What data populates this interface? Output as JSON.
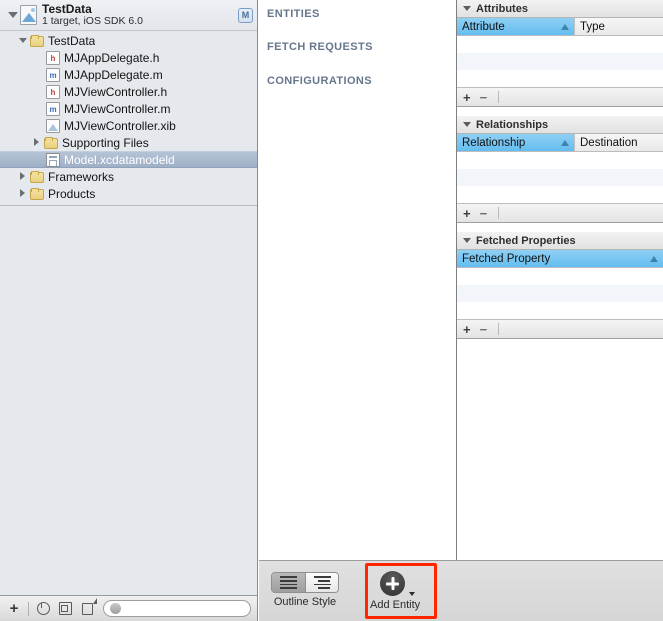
{
  "navigator": {
    "project": {
      "name": "TestData",
      "subtitle": "1 target, iOS SDK 6.0",
      "badge": "M"
    },
    "rows": [
      {
        "label": "TestData",
        "icon": "folder-icon",
        "twist": "open",
        "indent": 17,
        "selected": false
      },
      {
        "label": "MJAppDelegate.h",
        "icon": "header-file-icon",
        "twist": "none",
        "indent": 45,
        "selected": false
      },
      {
        "label": "MJAppDelegate.m",
        "icon": "implementation-file-icon",
        "twist": "none",
        "indent": 45,
        "selected": false
      },
      {
        "label": "MJViewController.h",
        "icon": "header-file-icon",
        "twist": "none",
        "indent": 45,
        "selected": false
      },
      {
        "label": "MJViewController.m",
        "icon": "implementation-file-icon",
        "twist": "none",
        "indent": 45,
        "selected": false
      },
      {
        "label": "MJViewController.xib",
        "icon": "xib-file-icon",
        "twist": "none",
        "indent": 45,
        "selected": false
      },
      {
        "label": "Supporting Files",
        "icon": "folder-icon",
        "twist": "closed",
        "indent": 31,
        "selected": false
      },
      {
        "label": "Model.xcdatamodeld",
        "icon": "datamodel-file-icon",
        "twist": "none",
        "indent": 45,
        "selected": true
      },
      {
        "label": "Frameworks",
        "icon": "folder-icon",
        "twist": "closed",
        "indent": 17,
        "selected": false
      },
      {
        "label": "Products",
        "icon": "folder-icon",
        "twist": "closed",
        "indent": 17,
        "selected": false
      }
    ],
    "bottom_bar": {
      "add_icon": "add-icon",
      "recent_icon": "clock-icon",
      "source_control_icon": "source-control-icon",
      "edit_icon": "edit-filter-icon",
      "search_placeholder": ""
    }
  },
  "editor": {
    "sections": [
      {
        "label": "ENTITIES"
      },
      {
        "label": "FETCH REQUESTS"
      },
      {
        "label": "CONFIGURATIONS"
      }
    ],
    "bottom_bar": {
      "outline_style_label": "Outline Style",
      "add_entity_label": "Add Entity",
      "outline_style_selected_index": 0,
      "highlight_color": "#ff2600"
    }
  },
  "inspector": {
    "panels": [
      {
        "title": "Attributes",
        "columns": [
          {
            "label": "Attribute",
            "sorted": true,
            "sort_direction": "ascending"
          },
          {
            "label": "Type",
            "sorted": false
          }
        ],
        "rows": [],
        "footer": {
          "add": "+",
          "remove": "−"
        }
      },
      {
        "title": "Relationships",
        "columns": [
          {
            "label": "Relationship",
            "sorted": true,
            "sort_direction": "ascending"
          },
          {
            "label": "Destination",
            "sorted": false
          }
        ],
        "rows": [],
        "footer": {
          "add": "+",
          "remove": "−"
        }
      },
      {
        "title": "Fetched Properties",
        "columns": [
          {
            "label": "Fetched Property",
            "sorted": true,
            "sort_direction": "ascending"
          }
        ],
        "rows": [],
        "footer": {
          "add": "+",
          "remove": "−"
        }
      }
    ]
  }
}
